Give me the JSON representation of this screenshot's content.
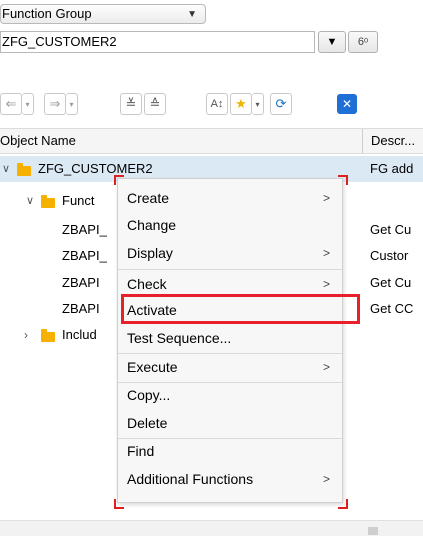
{
  "object_type": {
    "selected": "Function Group"
  },
  "object_name": {
    "value": "ZFG_CUSTOMER2"
  },
  "columns": {
    "name": "Object Name",
    "desc": "Descr..."
  },
  "tree": [
    {
      "label": "ZFG_CUSTOMER2",
      "desc": "FG add",
      "selected": true,
      "expanded": true
    },
    {
      "label": "Funct",
      "desc": "",
      "expanded": true
    },
    {
      "label": "ZBAPI_",
      "desc": "Get Cu"
    },
    {
      "label": "ZBAPI_",
      "desc": "Custor"
    },
    {
      "label": "ZBAPI",
      "desc": "Get Cu"
    },
    {
      "label": "ZBAPI",
      "desc": "Get CC"
    },
    {
      "label": "Includ",
      "desc": "",
      "expanded": false
    }
  ],
  "context_menu": [
    {
      "label": "Create",
      "submenu": true
    },
    {
      "label": "Change",
      "submenu": false
    },
    {
      "label": "Display",
      "submenu": true
    },
    {
      "label": "Check",
      "submenu": true
    },
    {
      "label": "Activate",
      "submenu": false
    },
    {
      "label": "Test Sequence...",
      "submenu": false
    },
    {
      "label": "Execute",
      "submenu": true
    },
    {
      "label": "Copy...",
      "submenu": false
    },
    {
      "label": "Delete",
      "submenu": false
    },
    {
      "label": "Find",
      "submenu": false
    },
    {
      "label": "Additional Functions",
      "submenu": true
    }
  ],
  "highlight_color": "#e8202a",
  "selection_color": "#dbe9f5"
}
